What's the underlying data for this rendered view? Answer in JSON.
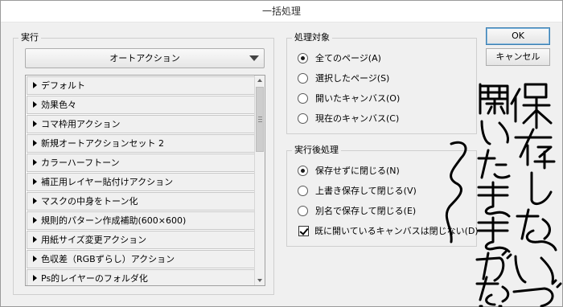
{
  "window": {
    "title": "一括処理"
  },
  "execute_group": {
    "label": "実行",
    "action_set_dropdown": "オートアクション",
    "actions": [
      "デフォルト",
      "効果色々",
      "コマ枠用アクション",
      "新規オートアクションセット 2",
      "カラーハーフトーン",
      "補正用レイヤー貼付けアクション",
      "マスクの中身をトーン化",
      "規則的パターン作成補助(600×600)",
      "用紙サイズ変更アクション",
      "色収差（RGBずらし）アクション",
      "Ps的レイヤーのフォルダ化"
    ]
  },
  "target_group": {
    "label": "処理対象",
    "options": [
      {
        "label": "全てのページ(A)",
        "selected": true
      },
      {
        "label": "選択したページ(S)",
        "selected": false
      },
      {
        "label": "開いたキャンバス(O)",
        "selected": false
      },
      {
        "label": "現在のキャンバス(C)",
        "selected": false
      }
    ]
  },
  "after_group": {
    "label": "実行後処理",
    "options": [
      {
        "label": "保存せずに閉じる(N)",
        "selected": true
      },
      {
        "label": "上書き保存して閉じる(V)",
        "selected": false
      },
      {
        "label": "別名で保存して閉じる(E)",
        "selected": false
      }
    ],
    "checkbox": {
      "label": "既に開いているキャンバスは閉じない(D)",
      "checked": true
    }
  },
  "buttons": {
    "ok": "OK",
    "cancel": "キャンセル"
  },
  "handwritten_annotation": {
    "column_1": "保存しないで",
    "column_2": "開いたままがない"
  },
  "colors": {
    "dialog_bg": "#f0f0f0",
    "ink": "#000000",
    "default_button_border": "#3c7fb1"
  }
}
